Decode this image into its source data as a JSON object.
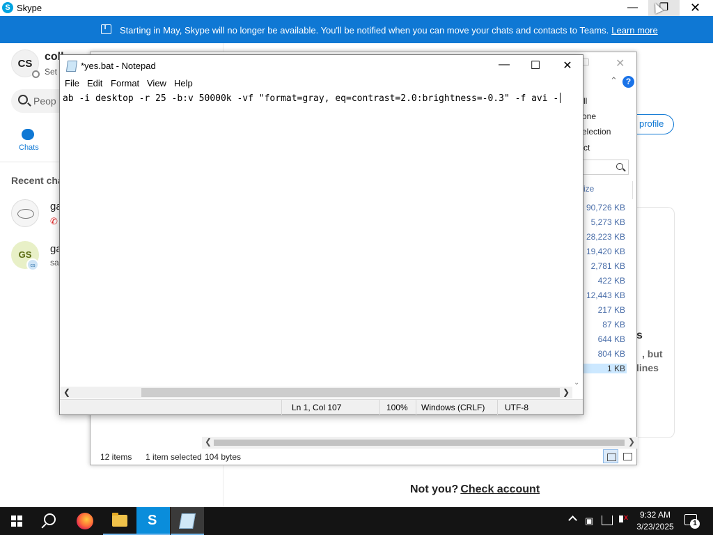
{
  "skype": {
    "app_title": "Skype",
    "logo_glyph": "S",
    "banner": {
      "message": "Starting in May, Skype will no longer be available. You'll be notified when you can move your chats and contacts to Teams.",
      "link": "Learn more"
    },
    "profile": {
      "initials": "CS",
      "name": "coll",
      "status": "Set"
    },
    "search_placeholder": "Peop",
    "nav_chats_label": "Chats",
    "recent_chats_label": "Recent cha",
    "chats": [
      {
        "name": "ga",
        "icon": "missed-call-icon"
      },
      {
        "name": "ga",
        "initials": "GS",
        "mini_initials": "cs",
        "subtitle": "sa"
      }
    ],
    "profile_button": "profile",
    "card_text": [
      "s",
      ", but",
      "lines"
    ],
    "not_you": "Not you?",
    "check_account": "Check account"
  },
  "explorer": {
    "ribbon_items": [
      "ll",
      "one",
      "election",
      "ct"
    ],
    "column_header": "ize",
    "sizes": [
      "90,726 KB",
      "5,273 KB",
      "28,223 KB",
      "19,420 KB",
      "2,781 KB",
      "422 KB",
      "12,443 KB",
      "217 KB",
      "87 KB",
      "644 KB",
      "804 KB",
      "1 KB"
    ],
    "selected_index": 11,
    "status": {
      "items": "12 items",
      "selected": "1 item selected",
      "size": "104 bytes"
    }
  },
  "notepad": {
    "title": "*yes.bat - Notepad",
    "menu": [
      "File",
      "Edit",
      "Format",
      "View",
      "Help"
    ],
    "content": "ab -i desktop -r 25 -b:v 50000k -vf \"format=gray, eq=contrast=2.0:brightness=-0.3\" -f avi -",
    "status": {
      "position": "Ln 1, Col 107",
      "zoom": "100%",
      "line_endings": "Windows (CRLF)",
      "encoding": "UTF-8"
    }
  },
  "taskbar": {
    "apps": [
      "start-icon",
      "search-icon",
      "firefox-icon",
      "file-explorer-icon",
      "skype-icon",
      "notepad-icon"
    ],
    "time": "9:32 AM",
    "date": "3/23/2025",
    "notification_count": "1"
  },
  "colors": {
    "skype_blue": "#0f78d4",
    "taskbar": "#141414",
    "selection": "#cce8ff"
  }
}
